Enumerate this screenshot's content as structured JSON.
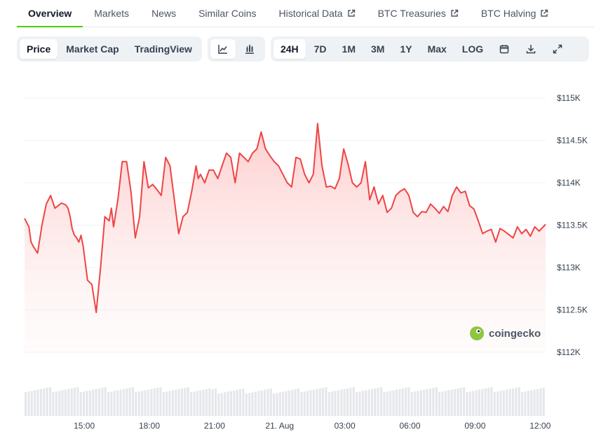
{
  "tabs": [
    {
      "label": "Overview",
      "active": true,
      "external": false
    },
    {
      "label": "Markets",
      "active": false,
      "external": false
    },
    {
      "label": "News",
      "active": false,
      "external": false
    },
    {
      "label": "Similar Coins",
      "active": false,
      "external": false
    },
    {
      "label": "Historical Data",
      "active": false,
      "external": true
    },
    {
      "label": "BTC Treasuries",
      "active": false,
      "external": true
    },
    {
      "label": "BTC Halving",
      "active": false,
      "external": true
    }
  ],
  "toolbar": {
    "metric_buttons": [
      "Price",
      "Market Cap",
      "TradingView"
    ],
    "selected_metric": "Price",
    "chart_style_icons": [
      "line-chart-icon",
      "candlestick-icon"
    ],
    "selected_style": "line-chart-icon",
    "range_buttons": [
      "24H",
      "7D",
      "1M",
      "3M",
      "1Y",
      "Max",
      "LOG"
    ],
    "selected_range": "24H",
    "action_icons": [
      "calendar-icon",
      "download-icon",
      "expand-icon"
    ]
  },
  "colors": {
    "line": "#ef4444",
    "fill_top": "#fecaca",
    "accent_tab": "#4bcc00",
    "grid": "#eef0f3",
    "volume": "#e5e7eb"
  },
  "watermark": "coingecko",
  "chart_data": {
    "type": "area",
    "title": "",
    "xlabel": "",
    "ylabel": "",
    "y_unit_prefix": "$",
    "ylim": [
      112000,
      115000
    ],
    "y_ticks": [
      "$115K",
      "$114.5K",
      "$114K",
      "$113.5K",
      "$113K",
      "$112.5K",
      "$112K"
    ],
    "y_tick_values": [
      115000,
      114500,
      114000,
      113500,
      113000,
      112500,
      112000
    ],
    "x_ticks": [
      "15:00",
      "18:00",
      "21:00",
      "21. Aug",
      "03:00",
      "06:00",
      "09:00",
      "12:00"
    ],
    "x_tick_hours": [
      2.75,
      5.75,
      8.75,
      11.75,
      14.75,
      17.75,
      20.75,
      23.75
    ],
    "grid": true,
    "legend": "none",
    "series": [
      {
        "hours": [
          0,
          0.2,
          0.3,
          0.4,
          0.6,
          0.8,
          1.0,
          1.2,
          1.4,
          1.5,
          1.7,
          1.9,
          2.0,
          2.1,
          2.2,
          2.3,
          2.4,
          2.5,
          2.6,
          2.7,
          2.9,
          3.1,
          3.3,
          3.5,
          3.7,
          3.9,
          4.0,
          4.1,
          4.3,
          4.5,
          4.7,
          4.9,
          5.1,
          5.3,
          5.5,
          5.7,
          5.9,
          6.1,
          6.3,
          6.5,
          6.7,
          6.9,
          7.1,
          7.3,
          7.5,
          7.7,
          7.9,
          8.0,
          8.1,
          8.3,
          8.5,
          8.7,
          8.9,
          9.1,
          9.3,
          9.5,
          9.7,
          9.9,
          10.1,
          10.3,
          10.5,
          10.7,
          10.9,
          11.1,
          11.3,
          11.5,
          11.7,
          11.9,
          12.1,
          12.3,
          12.5,
          12.7,
          12.9,
          13.1,
          13.3,
          13.5,
          13.7,
          13.9,
          14.1,
          14.3,
          14.5,
          14.7,
          14.9,
          15.1,
          15.3,
          15.5,
          15.7,
          15.9,
          16.1,
          16.3,
          16.5,
          16.7,
          16.9,
          17.1,
          17.3,
          17.5,
          17.7,
          17.9,
          18.1,
          18.3,
          18.5,
          18.7,
          18.9,
          19.1,
          19.3,
          19.5,
          19.7,
          19.9,
          20.1,
          20.3,
          20.5,
          20.7,
          20.9,
          21.1,
          21.3,
          21.5,
          21.7,
          21.9,
          22.1,
          22.3,
          22.5,
          22.7,
          22.9,
          23.1,
          23.3,
          23.5,
          23.7,
          24.0
        ],
        "values": [
          113580,
          113480,
          113300,
          113250,
          113170,
          113500,
          113750,
          113850,
          113700,
          113720,
          113760,
          113740,
          113700,
          113600,
          113450,
          113380,
          113350,
          113300,
          113380,
          113250,
          112850,
          112800,
          112470,
          113000,
          113600,
          113550,
          113700,
          113480,
          113800,
          114250,
          114250,
          113900,
          113350,
          113600,
          114250,
          113940,
          113980,
          113920,
          113850,
          114300,
          114200,
          113800,
          113400,
          113600,
          113650,
          113900,
          114200,
          114050,
          114100,
          114000,
          114150,
          114150,
          114050,
          114200,
          114350,
          114300,
          114000,
          114350,
          114300,
          114250,
          114350,
          114400,
          114600,
          114400,
          114320,
          114250,
          114200,
          114100,
          114000,
          113950,
          114300,
          114280,
          114100,
          114000,
          114100,
          114700,
          114200,
          113950,
          113960,
          113930,
          114050,
          114400,
          114220,
          114000,
          113950,
          114000,
          114250,
          113800,
          113950,
          113750,
          113850,
          113650,
          113700,
          113850,
          113900,
          113930,
          113850,
          113650,
          113600,
          113660,
          113650,
          113750,
          113700,
          113640,
          113720,
          113660,
          113850,
          113950,
          113880,
          113900,
          113730,
          113690,
          113550,
          113400,
          113430,
          113450,
          113300,
          113460,
          113430,
          113390,
          113350,
          113480,
          113400,
          113450,
          113370,
          113480,
          113430,
          113510
        ]
      }
    ],
    "volume_bars": "shown without scale"
  }
}
